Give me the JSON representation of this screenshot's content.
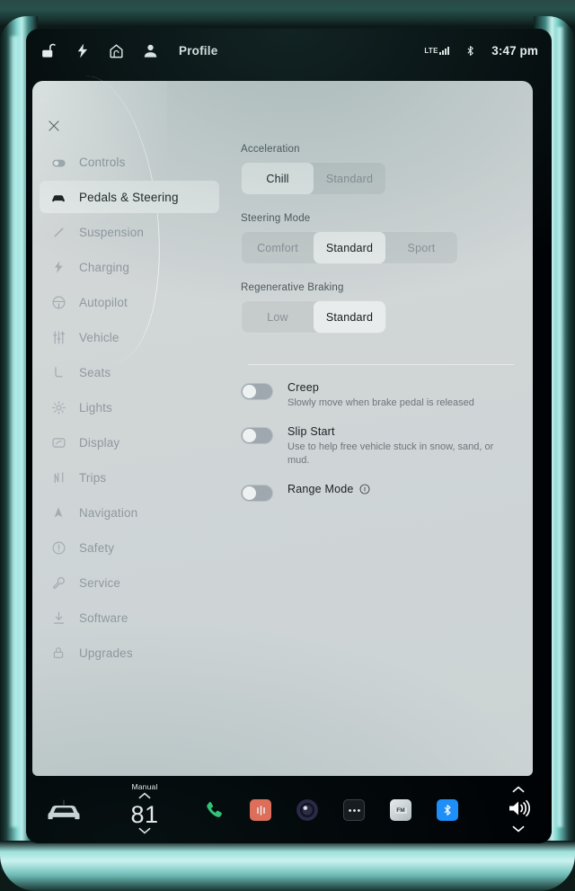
{
  "status_bar": {
    "icons": [
      "unlock-icon",
      "bolt-icon",
      "home-icon",
      "person-icon"
    ],
    "profile_label": "Profile",
    "network_label": "LTE",
    "bluetooth_icon": "bluetooth-icon",
    "time": "3:47 pm"
  },
  "panel": {
    "close_icon": "close-icon"
  },
  "sidebar": {
    "items": [
      {
        "label": "Controls",
        "icon": "toggle-icon",
        "active": false
      },
      {
        "label": "Pedals & Steering",
        "icon": "car-icon",
        "active": true
      },
      {
        "label": "Suspension",
        "icon": "suspension-icon",
        "active": false
      },
      {
        "label": "Charging",
        "icon": "bolt-icon",
        "active": false
      },
      {
        "label": "Autopilot",
        "icon": "steering-wheel-icon",
        "active": false
      },
      {
        "label": "Vehicle",
        "icon": "sliders-icon",
        "active": false
      },
      {
        "label": "Seats",
        "icon": "seat-icon",
        "active": false
      },
      {
        "label": "Lights",
        "icon": "sun-icon",
        "active": false
      },
      {
        "label": "Display",
        "icon": "display-icon",
        "active": false
      },
      {
        "label": "Trips",
        "icon": "road-icon",
        "active": false
      },
      {
        "label": "Navigation",
        "icon": "navigation-icon",
        "active": false
      },
      {
        "label": "Safety",
        "icon": "exclamation-circle-icon",
        "active": false
      },
      {
        "label": "Service",
        "icon": "wrench-icon",
        "active": false
      },
      {
        "label": "Software",
        "icon": "download-icon",
        "active": false
      },
      {
        "label": "Upgrades",
        "icon": "lock-icon",
        "active": false
      }
    ]
  },
  "content": {
    "acceleration": {
      "title": "Acceleration",
      "options": [
        "Chill",
        "Standard"
      ],
      "selected": "Chill"
    },
    "steering_mode": {
      "title": "Steering Mode",
      "options": [
        "Comfort",
        "Standard",
        "Sport"
      ],
      "selected": "Standard"
    },
    "regenerative_braking": {
      "title": "Regenerative Braking",
      "options": [
        "Low",
        "Standard"
      ],
      "selected": "Standard"
    },
    "toggles": [
      {
        "title": "Creep",
        "desc": "Slowly move when brake pedal is released",
        "on": false,
        "info": false
      },
      {
        "title": "Slip Start",
        "desc": "Use to help free vehicle stuck in snow, sand, or mud.",
        "on": false,
        "info": false
      },
      {
        "title": "Range Mode",
        "desc": "",
        "on": false,
        "info": true
      }
    ]
  },
  "taskbar": {
    "car_icon": "car-front-icon",
    "climate": {
      "mode": "Manual",
      "temperature": "81",
      "up_icon": "chevron-up-icon",
      "down_icon": "chevron-down-icon"
    },
    "apps": [
      {
        "name": "phone-icon"
      },
      {
        "name": "media-icon"
      },
      {
        "name": "camera-icon"
      },
      {
        "name": "more-dots-icon"
      },
      {
        "name": "fm-radio-icon",
        "label": "FM"
      },
      {
        "name": "bluetooth-icon"
      }
    ],
    "volume": {
      "up_icon": "chevron-up-icon",
      "speaker_icon": "speaker-icon",
      "down_icon": "chevron-down-icon"
    }
  },
  "colors": {
    "panel_bg": "#d4d8d9",
    "selected_seg": "#e9ecec",
    "accent_teal": "#8fdbd6",
    "phone_green": "#33d17a",
    "media_red": "#f2705a",
    "bluetooth_blue": "#1e90ff"
  }
}
